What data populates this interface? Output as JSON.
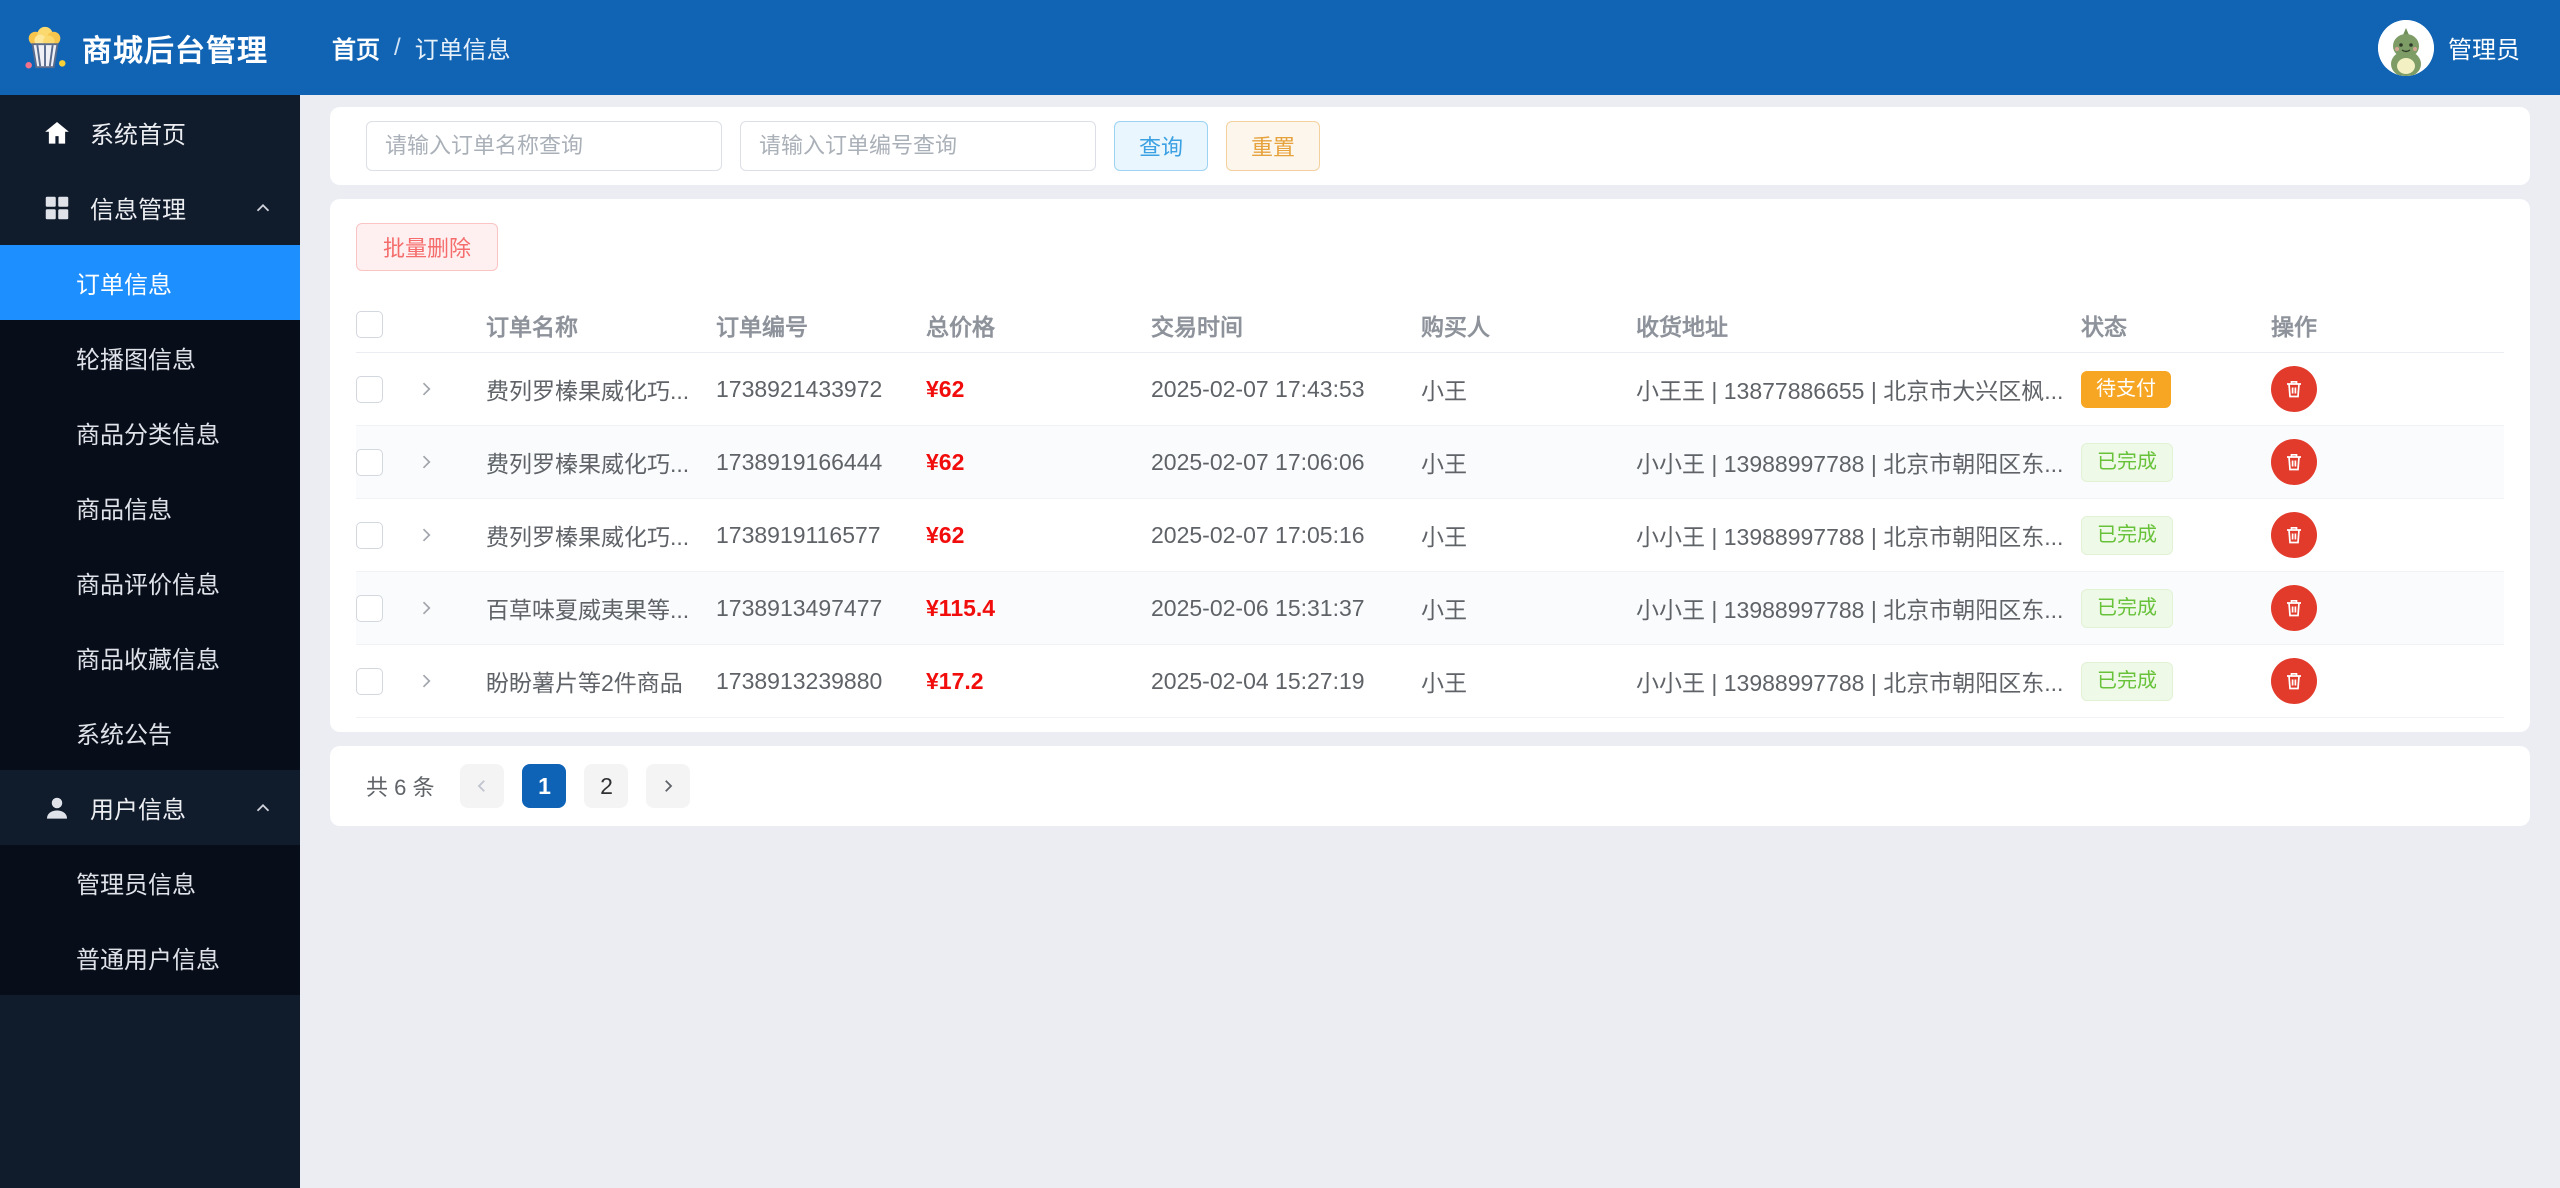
{
  "header": {
    "app_title": "商城后台管理",
    "breadcrumb": {
      "home": "首页",
      "separator": "/",
      "current": "订单信息"
    },
    "user": {
      "name": "管理员"
    }
  },
  "colors": {
    "header_blue": "#1164b4",
    "sidebar_dark": "#101b2c",
    "submenu_dark": "#070d19",
    "active_blue": "#1e8fff",
    "price_red": "#f20d0d",
    "delete_red": "#e23b2c",
    "status_pending_bg": "#f6a622",
    "status_done_text": "#67c23a",
    "pager_active_blue": "#0e63b6"
  },
  "sidebar": {
    "home": {
      "label": "系统首页",
      "icon": "home-icon"
    },
    "groups": [
      {
        "label": "信息管理",
        "icon": "grid-icon",
        "expanded": true,
        "children": [
          "订单信息",
          "轮播图信息",
          "商品分类信息",
          "商品信息",
          "商品评价信息",
          "商品收藏信息",
          "系统公告"
        ]
      },
      {
        "label": "用户信息",
        "icon": "user-icon",
        "expanded": true,
        "children": [
          "管理员信息",
          "普通用户信息"
        ]
      }
    ],
    "active_item": "订单信息"
  },
  "search": {
    "name_placeholder": "请输入订单名称查询",
    "no_placeholder": "请输入订单编号查询",
    "query_label": "查询",
    "reset_label": "重置"
  },
  "toolbar": {
    "batch_delete_label": "批量删除"
  },
  "table": {
    "columns": [
      "订单名称",
      "订单编号",
      "总价格",
      "交易时间",
      "购买人",
      "收货地址",
      "状态",
      "操作"
    ],
    "rows": [
      {
        "order_name": "费列罗榛果威化巧...",
        "order_no": "1738921433972",
        "price": "¥62",
        "time": "2025-02-07 17:43:53",
        "buyer": "小王",
        "address": "小王王 | 13877886655 | 北京市大兴区枫...",
        "status": "待支付",
        "status_type": "pending"
      },
      {
        "order_name": "费列罗榛果威化巧...",
        "order_no": "1738919166444",
        "price": "¥62",
        "time": "2025-02-07 17:06:06",
        "buyer": "小王",
        "address": "小小王 | 13988997788 | 北京市朝阳区东...",
        "status": "已完成",
        "status_type": "done"
      },
      {
        "order_name": "费列罗榛果威化巧...",
        "order_no": "1738919116577",
        "price": "¥62",
        "time": "2025-02-07 17:05:16",
        "buyer": "小王",
        "address": "小小王 | 13988997788 | 北京市朝阳区东...",
        "status": "已完成",
        "status_type": "done"
      },
      {
        "order_name": "百草味夏威夷果等...",
        "order_no": "1738913497477",
        "price": "¥115.4",
        "time": "2025-02-06 15:31:37",
        "buyer": "小王",
        "address": "小小王 | 13988997788 | 北京市朝阳区东...",
        "status": "已完成",
        "status_type": "done"
      },
      {
        "order_name": "盼盼薯片等2件商品",
        "order_no": "1738913239880",
        "price": "¥17.2",
        "time": "2025-02-04 15:27:19",
        "buyer": "小王",
        "address": "小小王 | 13988997788 | 北京市朝阳区东...",
        "status": "已完成",
        "status_type": "done"
      }
    ]
  },
  "pagination": {
    "total_label": "共 6 条",
    "page_1": "1",
    "page_2": "2",
    "active_page": "1"
  }
}
